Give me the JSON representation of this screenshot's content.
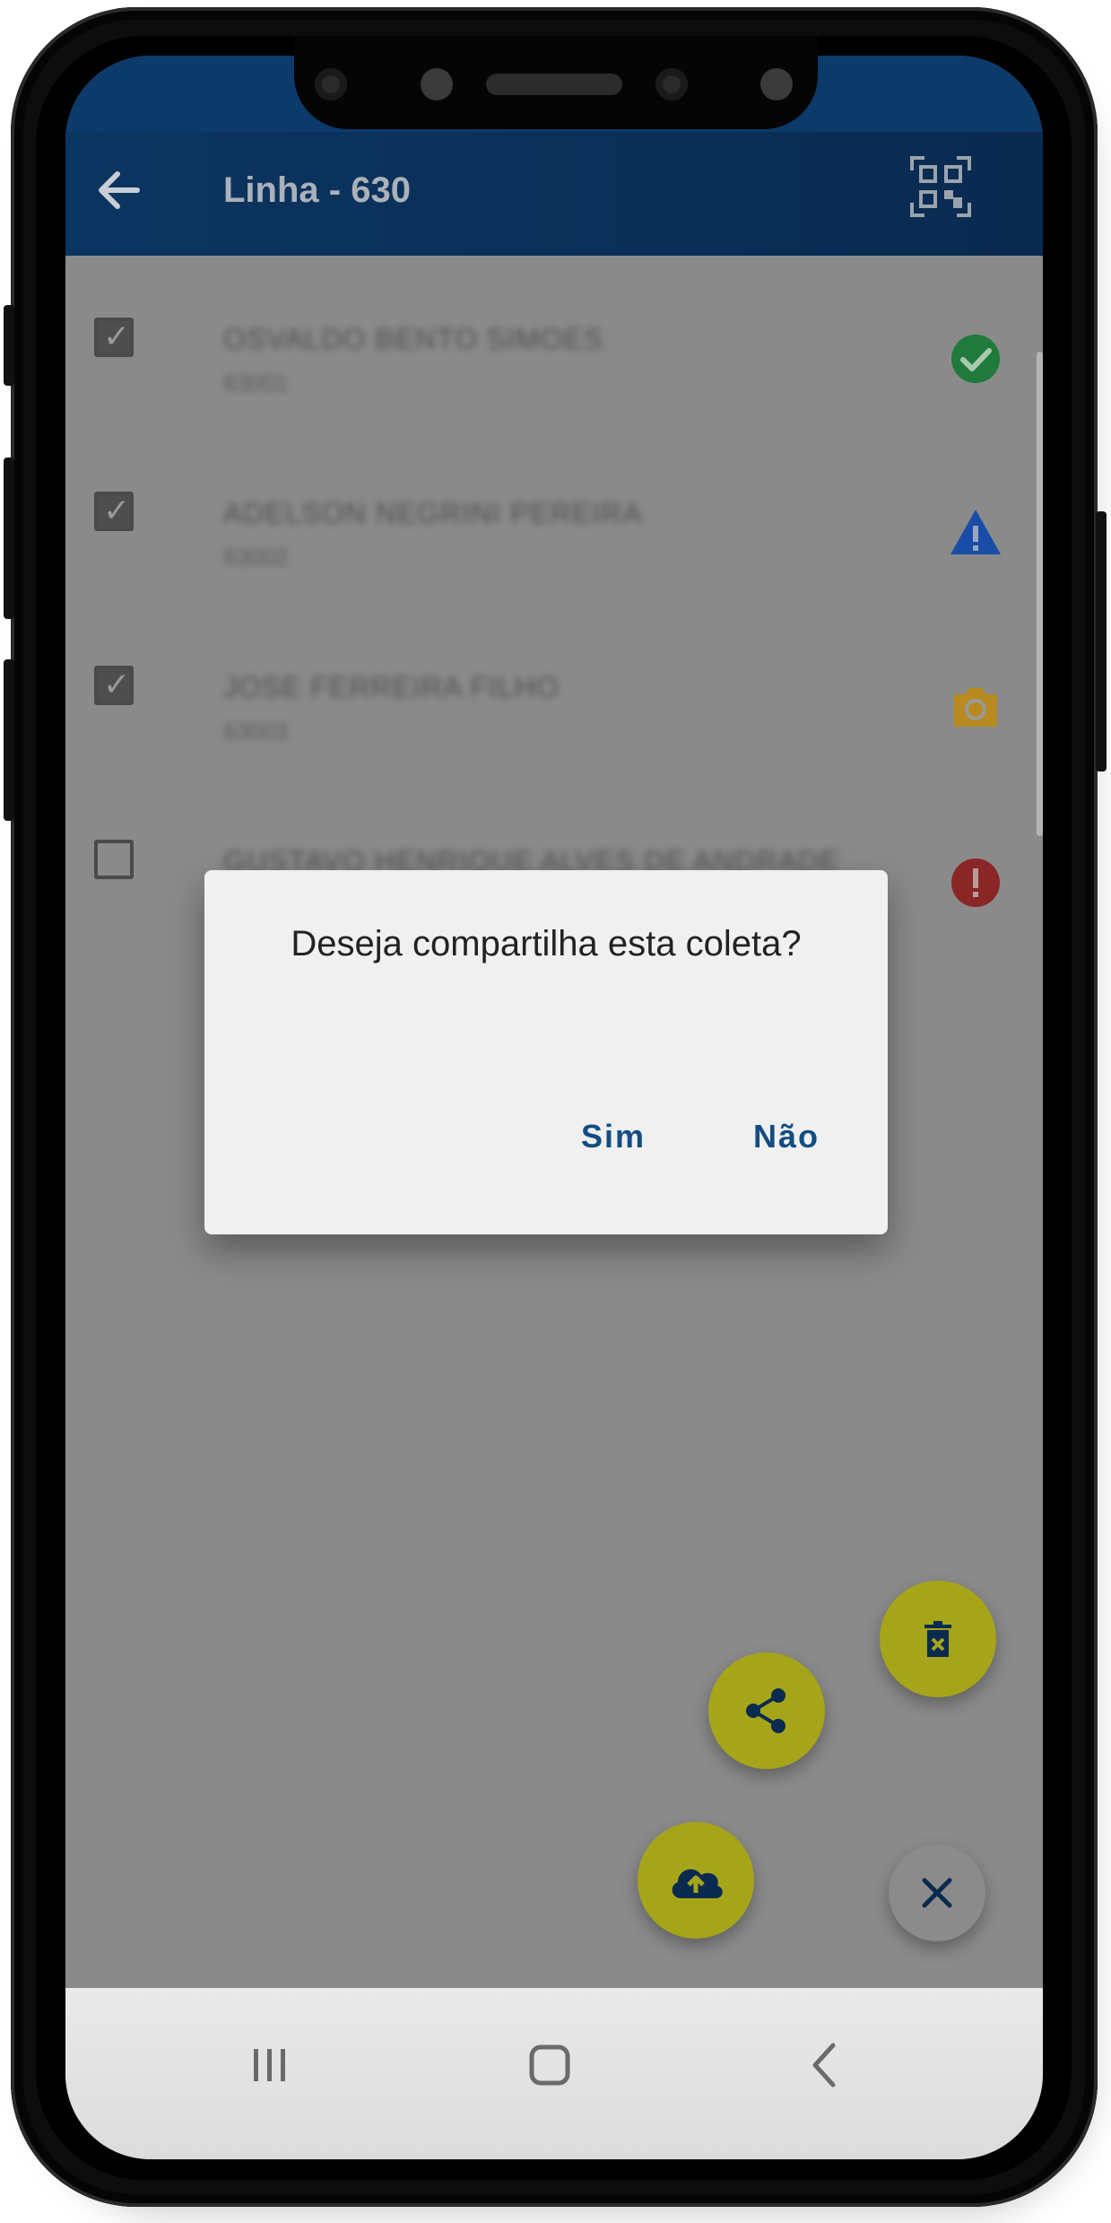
{
  "app_bar": {
    "title": "Linha - 630",
    "back_icon": "arrow-left-icon",
    "qr_icon": "qr-code-scan-icon"
  },
  "list": {
    "items": [
      {
        "name": "OSVALDO BENTO SIMOES",
        "code": "63001",
        "checked": true,
        "status_icon": "check-circle-icon",
        "status_color": "#1f7a3c"
      },
      {
        "name": "ADELSON NEGRINI PEREIRA",
        "code": "63002",
        "checked": true,
        "status_icon": "warning-triangle-icon",
        "status_color": "#1a4da8"
      },
      {
        "name": "JOSE FERREIRA FILHO",
        "code": "63003",
        "checked": true,
        "status_icon": "camera-icon",
        "status_color": "#b88a20"
      },
      {
        "name": "GUSTAVO HENRIQUE ALVES DE ANDRADE",
        "code": "",
        "checked": false,
        "status_icon": "error-circle-icon",
        "status_color": "#8b2626"
      }
    ]
  },
  "dialog": {
    "title": "Deseja compartilha esta coleta?",
    "confirm_label": "Sim",
    "cancel_label": "Não"
  },
  "fabs": {
    "delete_icon": "delete-forever-icon",
    "share_icon": "share-icon",
    "upload_icon": "cloud-upload-icon",
    "close_icon": "close-icon",
    "accent": "#a6a519"
  },
  "nav": {
    "recents_icon": "recents-icon",
    "home_icon": "home-icon",
    "back_icon": "chevron-left-icon"
  },
  "colors": {
    "app_bar": "#0b3561",
    "dialog_button": "#134d82"
  }
}
